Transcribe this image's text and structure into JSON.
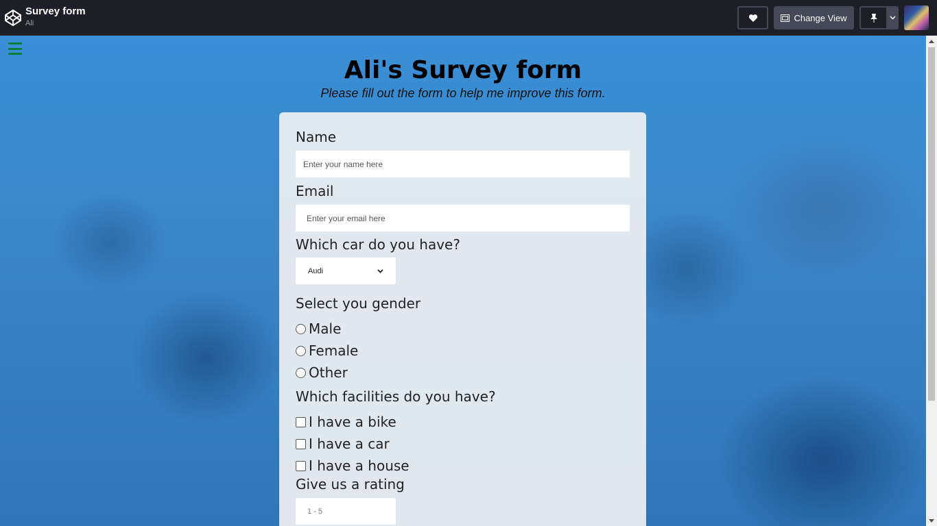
{
  "header": {
    "title": "Survey form",
    "owner": "Ali",
    "change_view_label": "Change View",
    "icons": [
      "codepen-logo-icon",
      "heart-icon",
      "layout-icon",
      "pin-icon",
      "chevron-down-icon"
    ]
  },
  "page": {
    "title": "Ali's Survey form",
    "subtitle": "Please fill out the form to help me improve this form."
  },
  "form": {
    "name_label": "Name",
    "name_placeholder": "Enter your name here",
    "email_label": "Email",
    "email_placeholder": "Enter your email here",
    "car_label": "Which car do you have?",
    "car_selected": "Audi",
    "gender_label": "Select you gender",
    "gender_options": [
      "Male",
      "Female",
      "Other"
    ],
    "facilities_label": "Which facilities do you have?",
    "facility_options": [
      "I have a bike",
      "I have a car",
      "I have a house"
    ],
    "rating_label": "Give us a rating",
    "rating_placeholder": "1 - 5"
  },
  "colors": {
    "topbar": "#1e1f26",
    "menu_icon": "#0a7d3a",
    "background_tint": "#3a8fd6",
    "card": "#eef0f3"
  }
}
